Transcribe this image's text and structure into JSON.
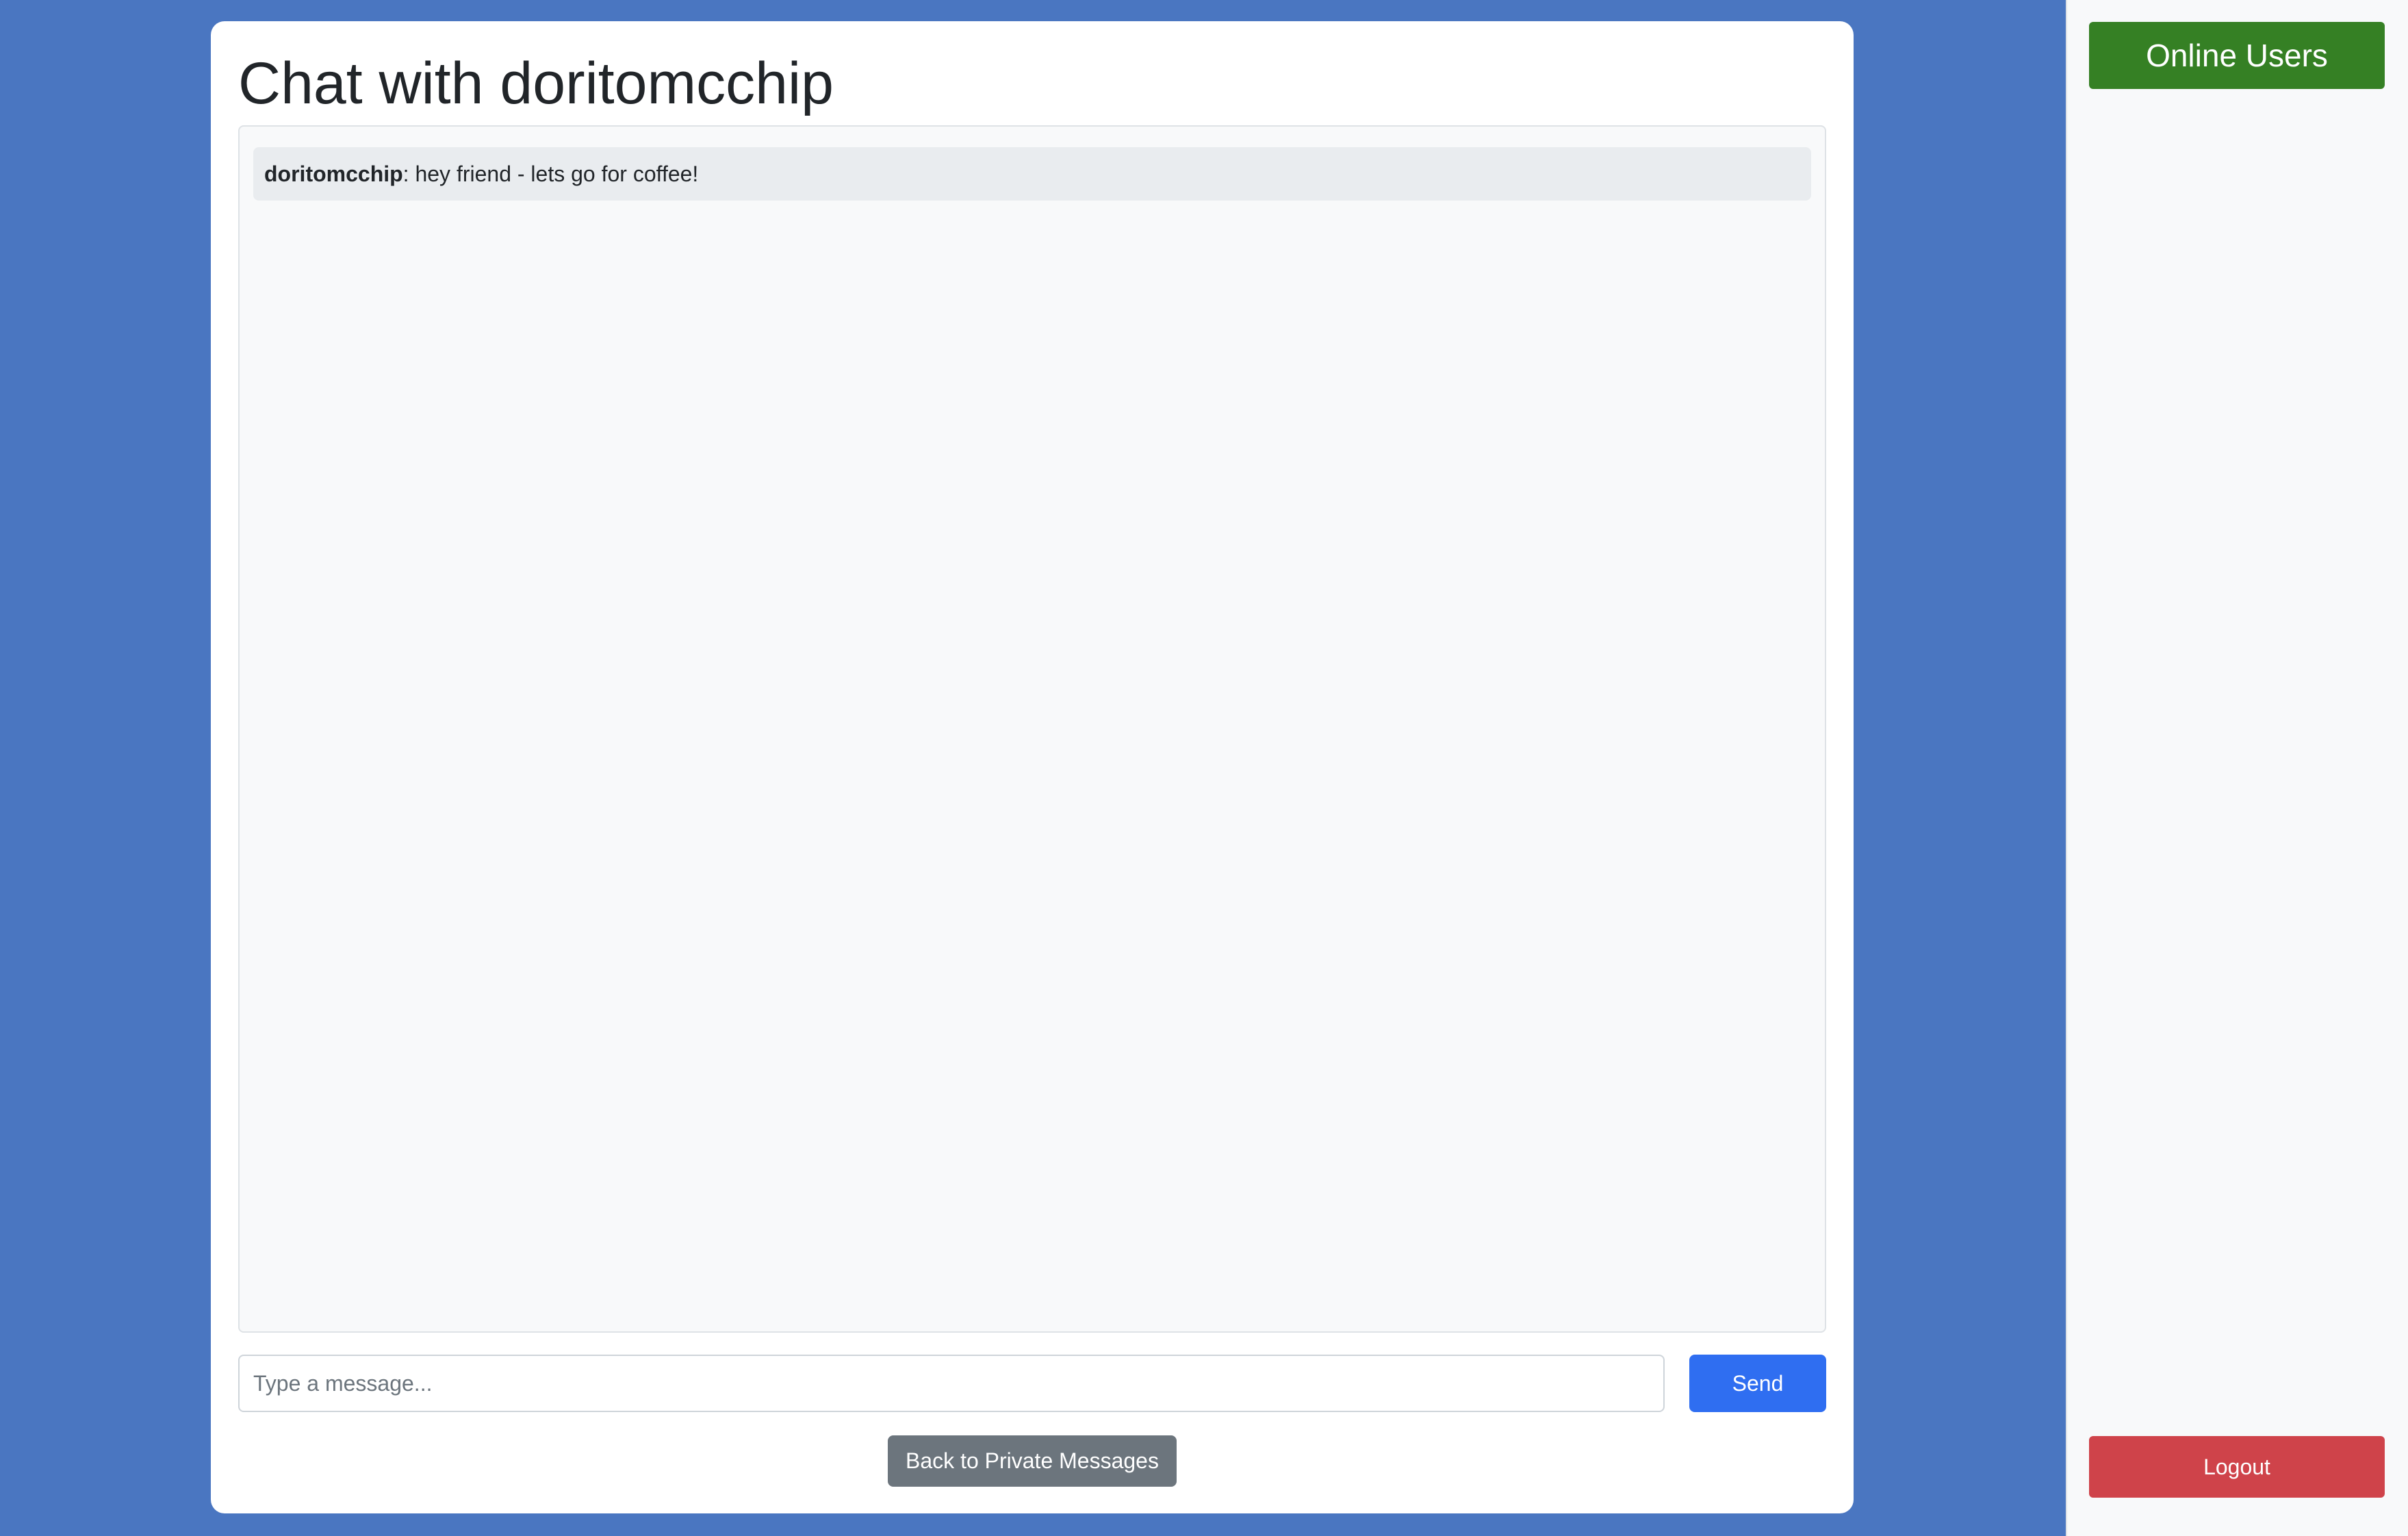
{
  "chat": {
    "title": "Chat with doritomcchip",
    "messages": [
      {
        "sender": "doritomcchip",
        "separator": ":",
        "text": " hey friend - lets go for coffee!"
      }
    ],
    "input": {
      "value": "",
      "placeholder": "Type a message..."
    },
    "send_label": "Send",
    "back_label": "Back to Private Messages"
  },
  "sidebar": {
    "online_users_label": "Online Users",
    "logout_label": "Logout"
  },
  "colors": {
    "page_background": "#4a76c1",
    "send_button": "#2f6ef1",
    "back_button": "#6c757d",
    "online_users_button": "#358024",
    "logout_button": "#cf434a"
  }
}
